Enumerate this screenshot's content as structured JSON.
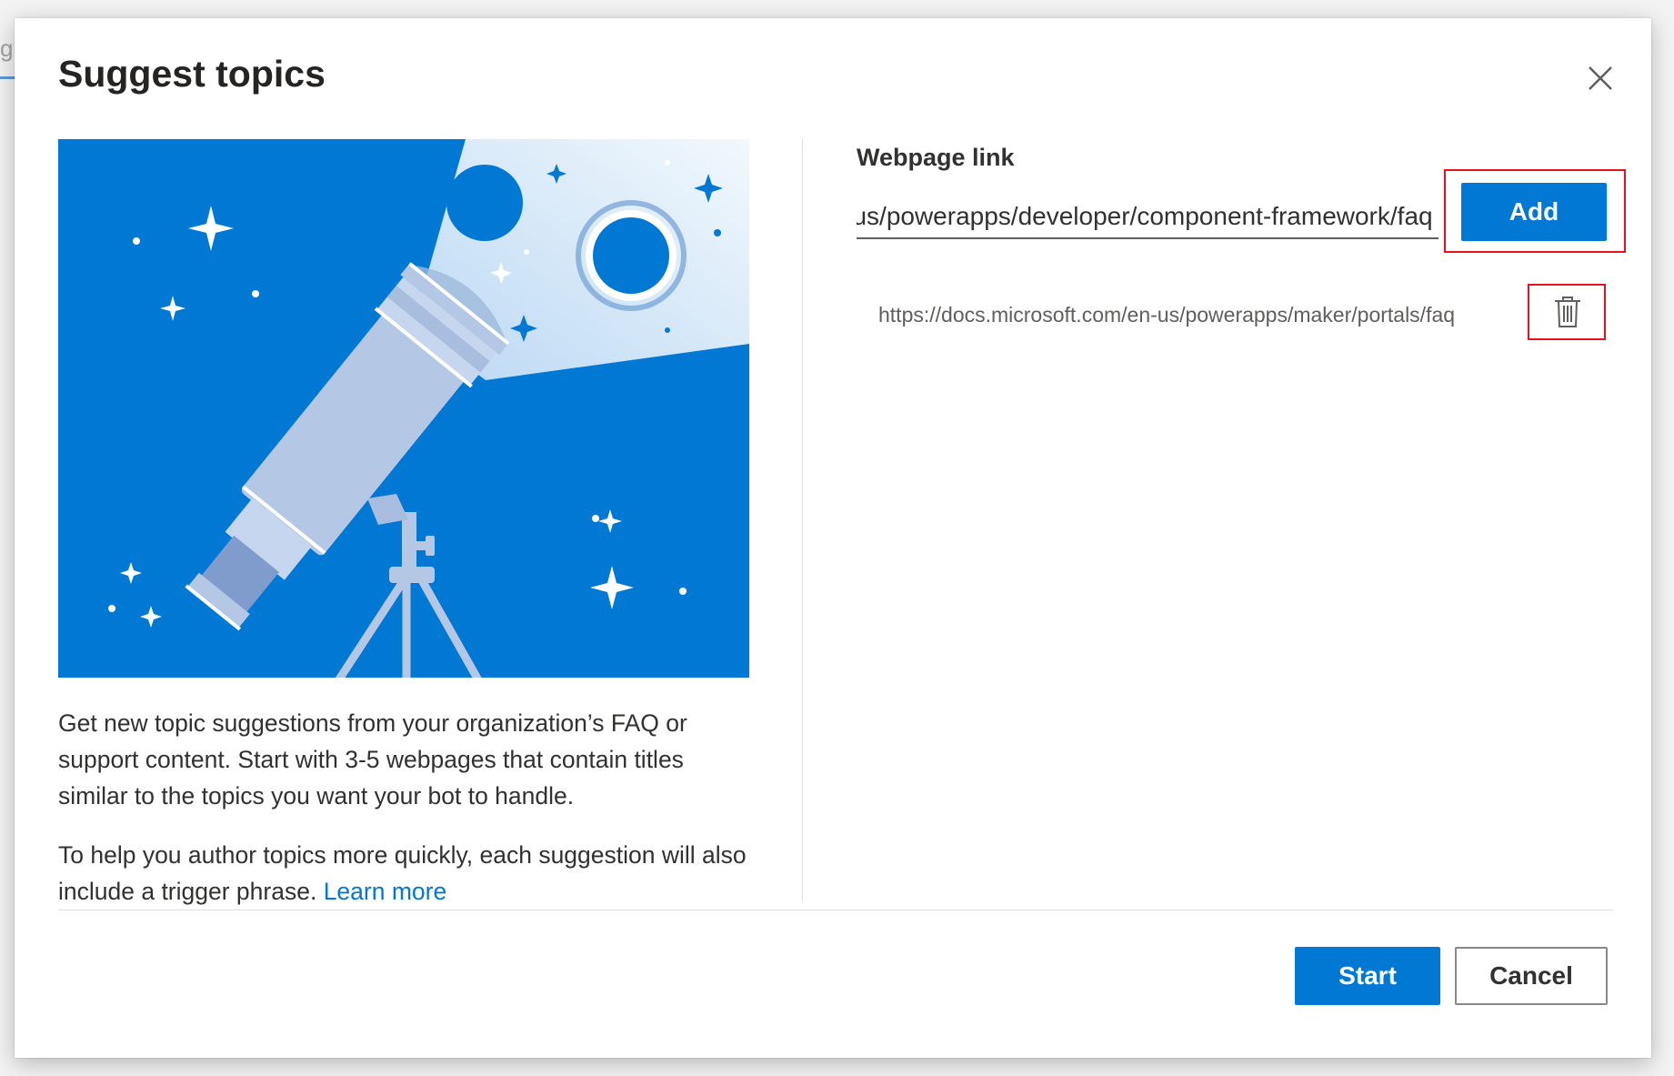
{
  "backdrop": {
    "fragment_text": "g"
  },
  "dialog": {
    "title": "Suggest topics",
    "close_icon": "close-icon"
  },
  "description": {
    "paragraph1": "Get new topic suggestions from your organization’s FAQ or support content. Start with 3-5 webpages that contain titles similar to the topics you want your bot to handle.",
    "paragraph2_text": "To help you author topics more quickly, each suggestion will also include a trigger phrase.",
    "learn_more": "Learn more"
  },
  "form": {
    "label": "Webpage link",
    "input_value": "https://docs.microsoft.com/en-us/powerapps/developer/component-framework/faq",
    "add_label": "Add"
  },
  "links": [
    {
      "url": "https://docs.microsoft.com/en-us/powerapps/maker/portals/faq",
      "delete_icon": "trash-icon"
    }
  ],
  "footer": {
    "start_label": "Start",
    "cancel_label": "Cancel"
  },
  "colors": {
    "accent": "#0078d4",
    "highlight": "#e81123",
    "illustration_bg": "#0078d4",
    "telescope": "#b4c8e6"
  }
}
